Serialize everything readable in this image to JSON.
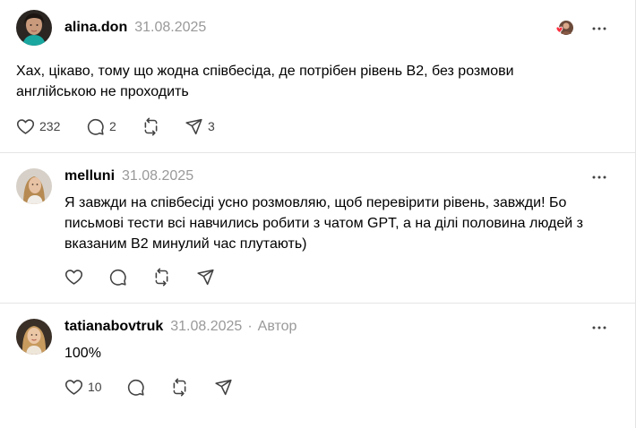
{
  "posts": [
    {
      "username": "alina.don",
      "date": "31.08.2025",
      "text": "Хах, цікаво, тому що жодна співбесіда, де потрібен рівень В2, без розмови англійською не проходить",
      "likes": "232",
      "replies": "2",
      "shares": "3"
    },
    {
      "username": "melluni",
      "date": "31.08.2025",
      "text": "Я завжди на співбесіді усно розмовляю, щоб перевірити рівень, завжди! Бо письмові тести всі навчились робити з чатом GPT, а на ділі половина людей з вказаним В2 минулий час плутають)"
    },
    {
      "username": "tatianabovtruk",
      "date": "31.08.2025",
      "separator": "·",
      "author_tag": "Автор",
      "text": "100%",
      "likes": "10"
    }
  ],
  "colors": {
    "text": "#000000",
    "muted": "#999999",
    "icon": "#424242",
    "divider": "#e5e5e5",
    "heart": "#ff3040"
  },
  "icons": [
    "heart-icon",
    "reply-icon",
    "repost-icon",
    "share-icon",
    "more-icon"
  ]
}
